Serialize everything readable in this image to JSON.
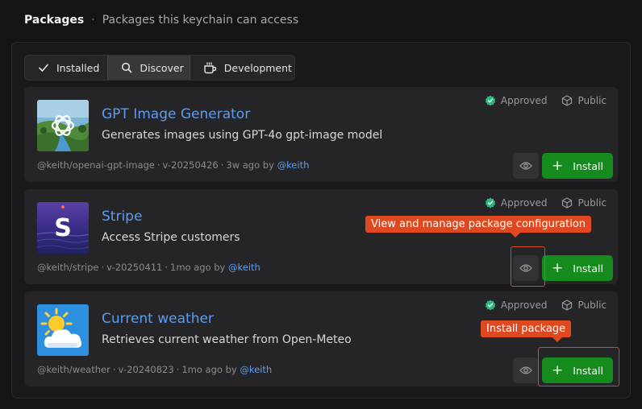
{
  "header": {
    "title": "Packages",
    "separator": "·",
    "subtitle": "Packages this keychain can access"
  },
  "tabs": [
    {
      "label": "Installed",
      "icon": "check-icon"
    },
    {
      "label": "Discover",
      "icon": "search-icon",
      "active": true
    },
    {
      "label": "Development",
      "icon": "coffee-cup-icon"
    }
  ],
  "badges": {
    "approved": "Approved",
    "public": "Public"
  },
  "packages": [
    {
      "name": "GPT Image Generator",
      "description": "Generates images using GPT-4o gpt-image model",
      "path": "@keith/openai-gpt-image",
      "version": "v-20250426",
      "age": "3w ago by",
      "author": "@keith",
      "install_label": "Install"
    },
    {
      "name": "Stripe",
      "description": "Access Stripe customers",
      "path": "@keith/stripe",
      "version": "v-20250411",
      "age": "1mo ago by",
      "author": "@keith",
      "install_label": "Install"
    },
    {
      "name": "Current weather",
      "description": "Retrieves current weather from Open-Meteo",
      "path": "@keith/weather",
      "version": "v-20240823",
      "age": "1mo ago by",
      "author": "@keith",
      "install_label": "Install"
    }
  ],
  "annotations": {
    "eye_callout": "View and manage package configuration",
    "install_callout": "Install package"
  },
  "colors": {
    "accent_link": "#5c9cf1",
    "install_green": "#158a1d",
    "approved_green": "#2fb87a",
    "callout_orange": "#e0491f"
  }
}
